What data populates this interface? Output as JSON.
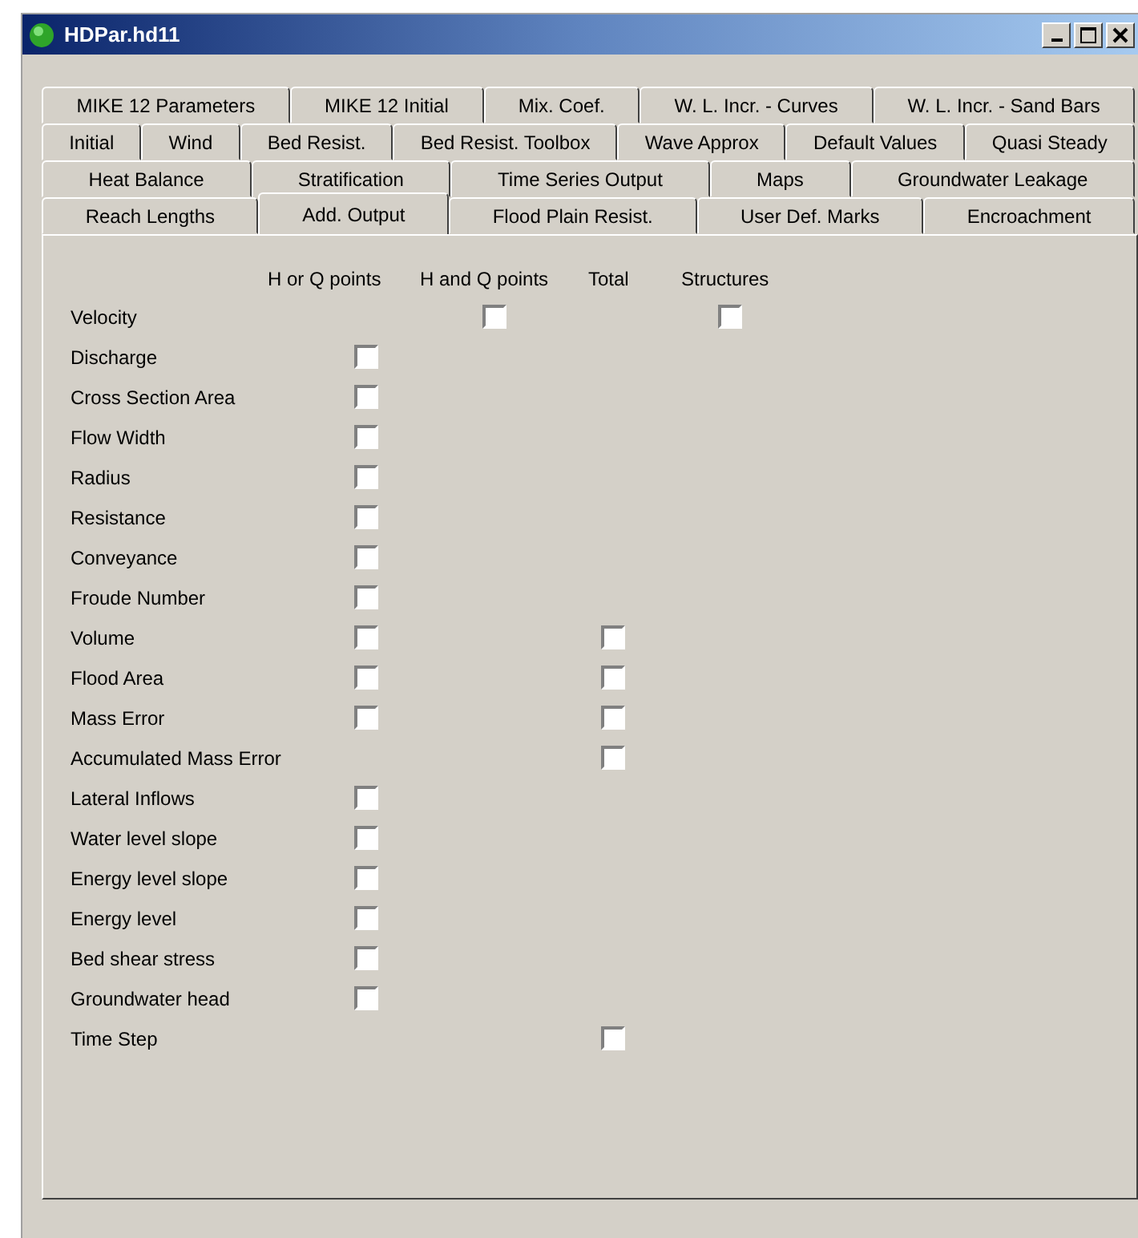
{
  "window": {
    "title": "HDPar.hd11"
  },
  "tab_rows": [
    [
      {
        "label": "MIKE 12 Parameters",
        "selected": false
      },
      {
        "label": "MIKE 12 Initial",
        "selected": false
      },
      {
        "label": "Mix. Coef.",
        "selected": false
      },
      {
        "label": "W. L. Incr. - Curves",
        "selected": false
      },
      {
        "label": "W. L. Incr. - Sand Bars",
        "selected": false
      }
    ],
    [
      {
        "label": "Initial",
        "selected": false
      },
      {
        "label": "Wind",
        "selected": false
      },
      {
        "label": "Bed Resist.",
        "selected": false
      },
      {
        "label": "Bed Resist. Toolbox",
        "selected": false
      },
      {
        "label": "Wave Approx",
        "selected": false
      },
      {
        "label": "Default Values",
        "selected": false
      },
      {
        "label": "Quasi Steady",
        "selected": false
      }
    ],
    [
      {
        "label": "Heat Balance",
        "selected": false
      },
      {
        "label": "Stratification",
        "selected": false
      },
      {
        "label": "Time Series Output",
        "selected": false
      },
      {
        "label": "Maps",
        "selected": false
      },
      {
        "label": "Groundwater Leakage",
        "selected": false
      }
    ],
    [
      {
        "label": "Reach Lengths",
        "selected": false
      },
      {
        "label": "Add. Output",
        "selected": true
      },
      {
        "label": "Flood Plain Resist.",
        "selected": false
      },
      {
        "label": "User Def. Marks",
        "selected": false
      },
      {
        "label": "Encroachment",
        "selected": false
      }
    ]
  ],
  "output_table": {
    "columns": {
      "h_or_q": "H or Q points",
      "h_and_q": "H and Q points",
      "total": "Total",
      "structures": "Structures"
    },
    "rows": [
      {
        "label": "Velocity",
        "h_and_q": {
          "checked": false
        },
        "structures": {
          "checked": false
        }
      },
      {
        "label": "Discharge",
        "h_or_q": {
          "checked": false
        }
      },
      {
        "label": "Cross Section Area",
        "h_or_q": {
          "checked": false
        }
      },
      {
        "label": "Flow Width",
        "h_or_q": {
          "checked": false
        }
      },
      {
        "label": "Radius",
        "h_or_q": {
          "checked": false
        }
      },
      {
        "label": "Resistance",
        "h_or_q": {
          "checked": false
        }
      },
      {
        "label": "Conveyance",
        "h_or_q": {
          "checked": false
        }
      },
      {
        "label": "Froude Number",
        "h_or_q": {
          "checked": false
        }
      },
      {
        "label": "Volume",
        "h_or_q": {
          "checked": false
        },
        "total": {
          "checked": false
        }
      },
      {
        "label": "Flood Area",
        "h_or_q": {
          "checked": false
        },
        "total": {
          "checked": false
        }
      },
      {
        "label": "Mass Error",
        "h_or_q": {
          "checked": false
        },
        "total": {
          "checked": false
        }
      },
      {
        "label": "Accumulated Mass Error",
        "total": {
          "checked": false
        }
      },
      {
        "label": "Lateral Inflows",
        "h_or_q": {
          "checked": false
        }
      },
      {
        "label": "Water level slope",
        "h_or_q": {
          "checked": false
        }
      },
      {
        "label": "Energy level slope",
        "h_or_q": {
          "checked": false
        }
      },
      {
        "label": "Energy level",
        "h_or_q": {
          "checked": false
        }
      },
      {
        "label": "Bed shear stress",
        "h_or_q": {
          "checked": false
        }
      },
      {
        "label": "Groundwater head",
        "h_or_q": {
          "checked": false
        }
      },
      {
        "label": "Time Step",
        "total": {
          "checked": false
        }
      }
    ]
  }
}
